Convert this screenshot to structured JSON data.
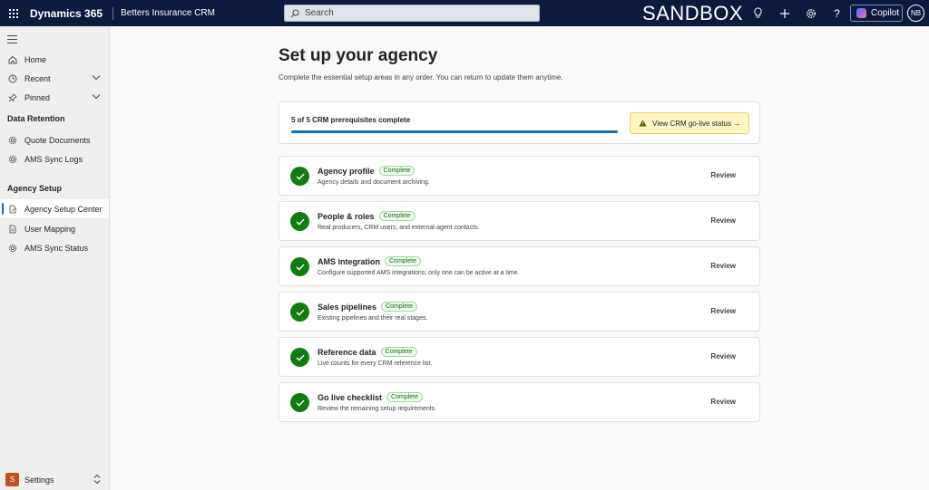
{
  "topbar": {
    "brand": "Dynamics 365",
    "app_name": "Betters Insurance CRM",
    "search_placeholder": "Search",
    "environment": "SANDBOX",
    "copilot_label": "Copilot",
    "user_initials": "NB"
  },
  "sidebar": {
    "top_items": [
      {
        "label": "Home",
        "icon": "home-icon"
      },
      {
        "label": "Recent",
        "icon": "clock-icon"
      },
      {
        "label": "Pinned",
        "icon": "pin-icon"
      }
    ],
    "groups": [
      {
        "label": "Data Retention",
        "items": [
          {
            "label": "Quote Documents",
            "icon": "gear-icon"
          },
          {
            "label": "AMS Sync Logs",
            "icon": "gear-icon"
          }
        ]
      },
      {
        "label": "Agency Setup",
        "items": [
          {
            "label": "Agency Setup Center",
            "icon": "document-edit-icon",
            "selected": true
          },
          {
            "label": "User Mapping",
            "icon": "document-icon"
          },
          {
            "label": "AMS Sync Status",
            "icon": "gear-icon"
          }
        ]
      }
    ],
    "area_switcher": {
      "badge": "S",
      "label": "Settings"
    }
  },
  "main": {
    "title": "Set up your agency",
    "subtitle": "Complete the essential setup areas in any order. You can return to update them anytime.",
    "progress": {
      "text": "5 of 5 CRM prerequisites complete",
      "fraction": 1.0,
      "go_live_label": "View CRM go-live status →"
    },
    "steps": [
      {
        "title": "Agency profile",
        "status": "Complete",
        "description": "Agency details and document archiving.",
        "action": "Review"
      },
      {
        "title": "People & roles",
        "status": "Complete",
        "description": "Real producers, CRM users, and external-agent contacts.",
        "action": "Review"
      },
      {
        "title": "AMS integration",
        "status": "Complete",
        "description": "Configure supported AMS integrations; only one can be active at a time.",
        "action": "Review"
      },
      {
        "title": "Sales pipelines",
        "status": "Complete",
        "description": "Existing pipelines and their real stages.",
        "action": "Review"
      },
      {
        "title": "Reference data",
        "status": "Complete",
        "description": "Live counts for every CRM reference list.",
        "action": "Review"
      },
      {
        "title": "Go live checklist",
        "status": "Complete",
        "description": "Review the remaining setup requirements.",
        "action": "Review"
      }
    ]
  },
  "colors": {
    "topbar": "#0b1a3d",
    "accent": "#0f6cbd",
    "success": "#107c10",
    "warning_bg": "#fdf6c3"
  }
}
